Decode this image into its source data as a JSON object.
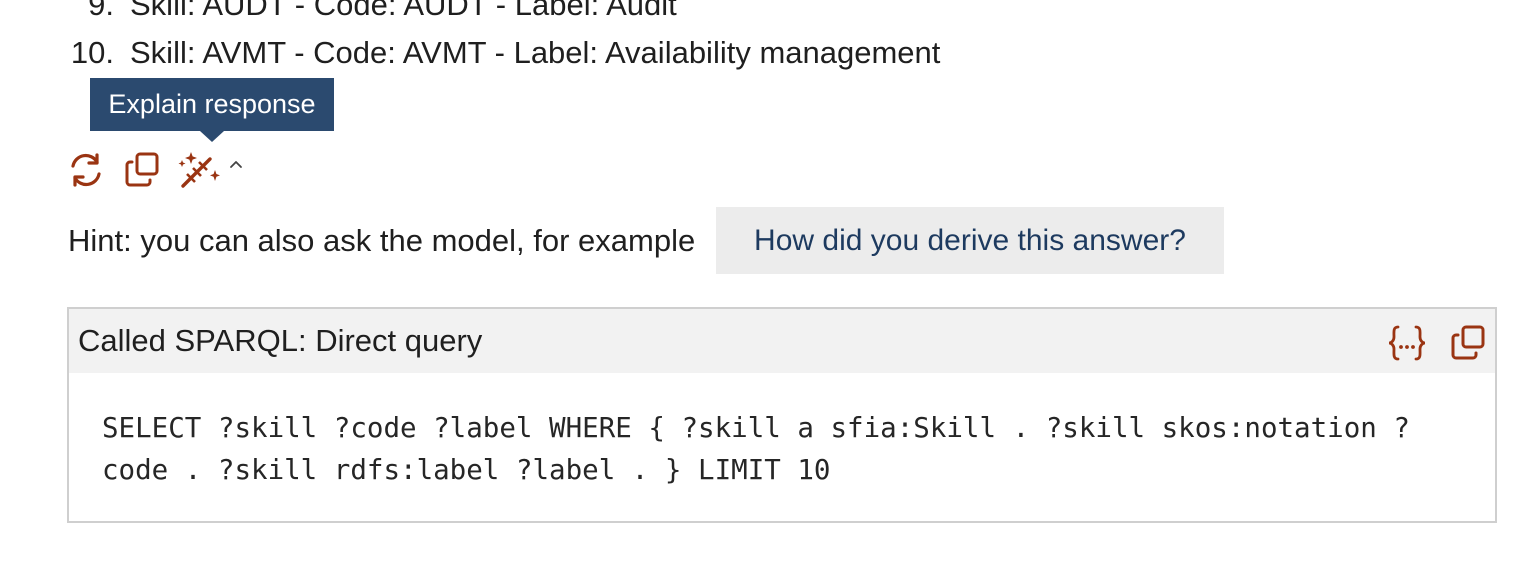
{
  "answer": {
    "items": [
      {
        "number": "9.",
        "text": "Skill: AUDT - Code: AUDT - Label: Audit"
      },
      {
        "number": "10.",
        "text": "Skill: AVMT - Code: AVMT - Label: Availability management"
      }
    ]
  },
  "tooltip": {
    "text": "Explain response"
  },
  "actions": {
    "regenerate_icon": "refresh-icon",
    "copy_icon": "copy-icon",
    "explain_icon": "magic-wand-icon",
    "explain_caret_icon": "chevron-up-icon"
  },
  "hint": {
    "label": "Hint",
    "text": ": you can also ask the model, for example",
    "suggestion": "How did you derive this answer?"
  },
  "tool_call": {
    "title": "Called SPARQL: Direct query",
    "query": "SELECT ?skill ?code ?label WHERE { ?skill a sfia:Skill . ?skill skos:notation ?code . ?skill rdfs:label ?label . } LIMIT 10",
    "show_icon": "code-braces-icon",
    "copy_icon": "copy-icon"
  },
  "colors": {
    "accent_icon": "#9a3412",
    "tooltip_bg": "#2b4a6f",
    "chip_text": "#1d3a5f",
    "chip_bg": "#ececec",
    "panel_header_bg": "#f2f2f2",
    "panel_border": "#cfcfcf"
  }
}
